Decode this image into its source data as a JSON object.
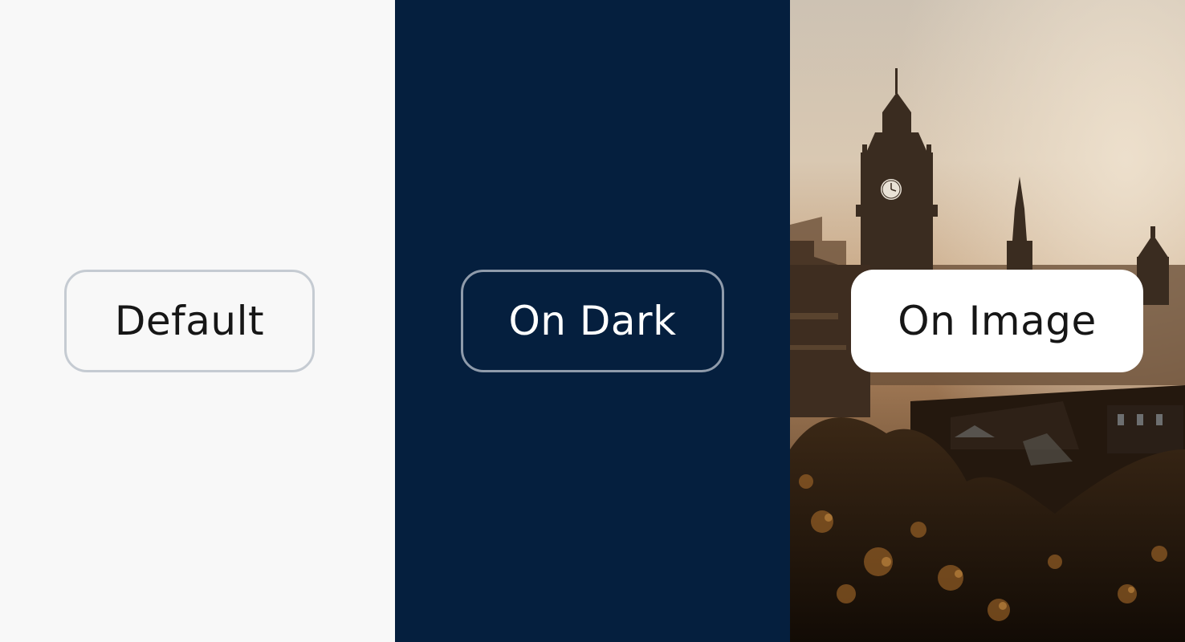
{
  "panels": {
    "default": {
      "button_label": "Default",
      "background": "#f8f8f8"
    },
    "dark": {
      "button_label": "On Dark",
      "background": "#051f3e"
    },
    "image": {
      "button_label": "On Image",
      "background_image": "city skyline with clock tower at sunset"
    }
  },
  "colors": {
    "default_border": "#c5cbd2",
    "dark_border": "#8f9bab",
    "text_dark": "#161616",
    "text_light": "#ffffff"
  }
}
